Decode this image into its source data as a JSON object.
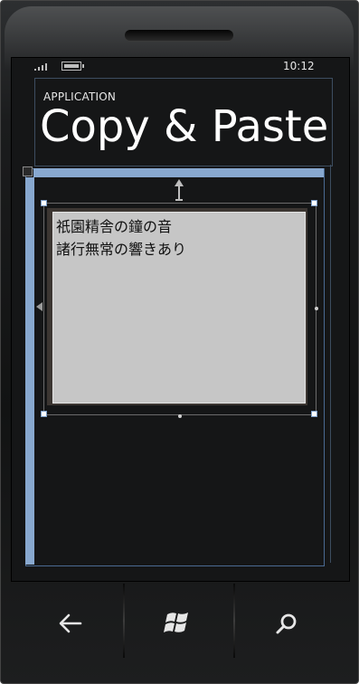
{
  "status_bar": {
    "time": "10:12",
    "signal_icon": "signal-icon",
    "battery_icon": "battery-icon"
  },
  "app": {
    "application_title": "APPLICATION",
    "page_title": "Copy & Paste"
  },
  "textbox": {
    "line1": "祇園精舎の鐘の音",
    "line2": "諸行無常の響きあり"
  },
  "hardware_buttons": [
    {
      "name": "back",
      "icon": "back-arrow-icon"
    },
    {
      "name": "start",
      "icon": "windows-logo-icon"
    },
    {
      "name": "search",
      "icon": "search-icon"
    }
  ],
  "colors": {
    "selection_blue": "#88a8cf",
    "textbox_bg": "#c6c6c6",
    "screen_bg": "#151617"
  }
}
